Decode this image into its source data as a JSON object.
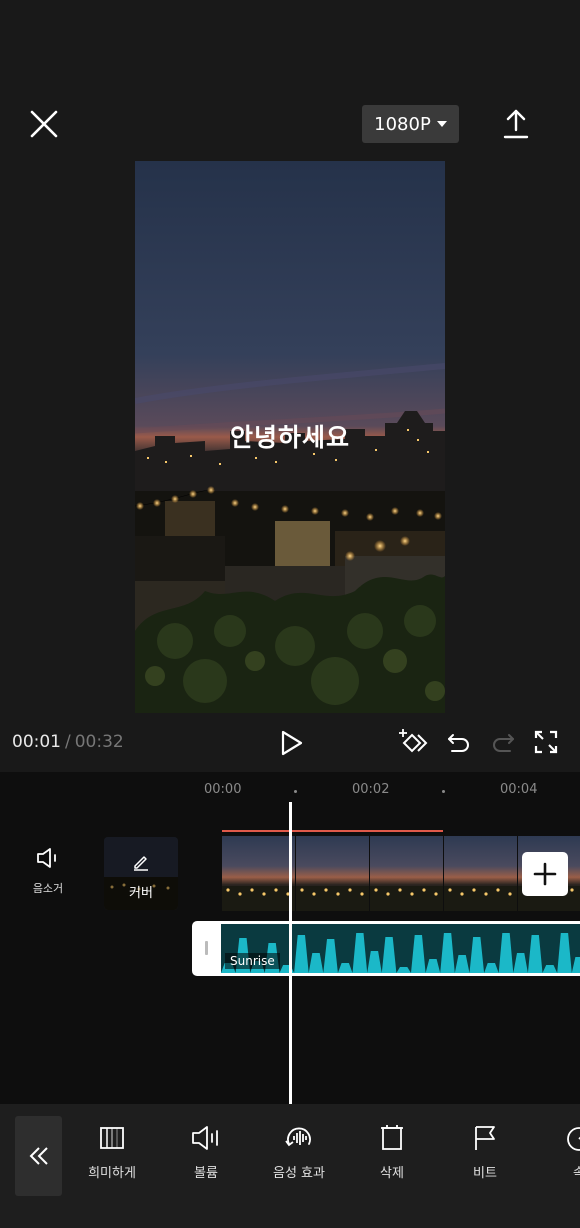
{
  "header": {
    "close_icon": "close-icon",
    "resolution": "1080P",
    "export_icon": "upload-icon"
  },
  "preview": {
    "caption": "안녕하세요"
  },
  "controls": {
    "current_time": "00:01",
    "separator": "/",
    "total_time": "00:32"
  },
  "timeline": {
    "ticks": [
      "00:00",
      "00:02",
      "00:04"
    ],
    "mute_label": "음소거",
    "cover_label": "커버",
    "audio_name": "Sunrise"
  },
  "toolbar": {
    "items": [
      {
        "label": "희미하게",
        "icon": "fade-icon"
      },
      {
        "label": "볼륨",
        "icon": "volume-icon"
      },
      {
        "label": "음성 효과",
        "icon": "voice-effect-icon"
      },
      {
        "label": "삭제",
        "icon": "delete-icon"
      },
      {
        "label": "비트",
        "icon": "beat-flag-icon"
      },
      {
        "label": "속",
        "icon": "speed-icon"
      }
    ]
  },
  "colors": {
    "background": "#191919",
    "timeline_bg": "#0e0e0e",
    "waveform": "#1bb8c8",
    "trim_line": "#e05a4a"
  }
}
